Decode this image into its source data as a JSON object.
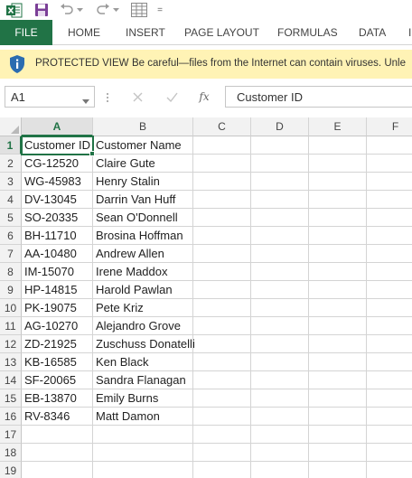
{
  "quick_access": {
    "icons": [
      "excel-logo-icon",
      "save-icon",
      "undo-icon",
      "redo-icon",
      "form-icon",
      "customize-qat-icon"
    ],
    "more_glyph": "="
  },
  "ribbon": {
    "tabs": [
      {
        "label": "FILE"
      },
      {
        "label": "HOME"
      },
      {
        "label": "INSERT"
      },
      {
        "label": "PAGE LAYOUT"
      },
      {
        "label": "FORMULAS"
      },
      {
        "label": "DATA"
      },
      {
        "label": "I"
      }
    ]
  },
  "protected_view": {
    "title": "PROTECTED VIEW",
    "message": "Be careful—files from the Internet can contain viruses. Unle",
    "icon": "shield-info-icon"
  },
  "formula_bar": {
    "name_box": "A1",
    "fx_label": "fx",
    "value": "Customer ID"
  },
  "sheet": {
    "columns": [
      "A",
      "B",
      "C",
      "D",
      "E",
      "F"
    ],
    "selected_cell": "A1",
    "rows": [
      {
        "n": "1",
        "a": "Customer ID",
        "b": "Customer Name"
      },
      {
        "n": "2",
        "a": "CG-12520",
        "b": "Claire Gute"
      },
      {
        "n": "3",
        "a": "WG-45983",
        "b": "Henry Stalin"
      },
      {
        "n": "4",
        "a": "DV-13045",
        "b": "Darrin Van Huff"
      },
      {
        "n": "5",
        "a": "SO-20335",
        "b": "Sean O'Donnell"
      },
      {
        "n": "6",
        "a": "BH-11710",
        "b": "Brosina Hoffman"
      },
      {
        "n": "7",
        "a": "AA-10480",
        "b": "Andrew Allen"
      },
      {
        "n": "8",
        "a": "IM-15070",
        "b": "Irene Maddox"
      },
      {
        "n": "9",
        "a": "HP-14815",
        "b": "Harold Pawlan"
      },
      {
        "n": "10",
        "a": "PK-19075",
        "b": "Pete Kriz"
      },
      {
        "n": "11",
        "a": "AG-10270",
        "b": "Alejandro Grove"
      },
      {
        "n": "12",
        "a": "ZD-21925",
        "b": "Zuschuss Donatelli"
      },
      {
        "n": "13",
        "a": "KB-16585",
        "b": "Ken Black"
      },
      {
        "n": "14",
        "a": "SF-20065",
        "b": "Sandra Flanagan"
      },
      {
        "n": "15",
        "a": "EB-13870",
        "b": "Emily Burns"
      },
      {
        "n": "16",
        "a": "RV-8346",
        "b": "Matt Damon"
      },
      {
        "n": "17",
        "a": "",
        "b": ""
      },
      {
        "n": "18",
        "a": "",
        "b": ""
      },
      {
        "n": "19",
        "a": "",
        "b": ""
      }
    ]
  },
  "colors": {
    "accent": "#217346",
    "protected_bar": "#fff3b5",
    "shield": "#2b6cb0"
  }
}
